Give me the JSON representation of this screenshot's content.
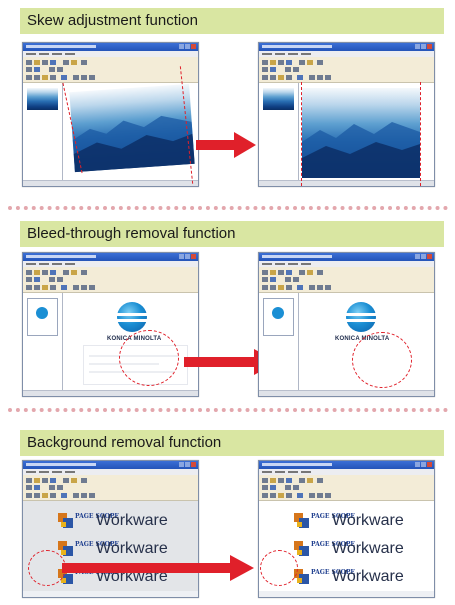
{
  "sections": [
    {
      "title": "Skew adjustment function"
    },
    {
      "title": "Bleed-through removal function"
    },
    {
      "title": "Background removal function"
    }
  ],
  "logo": {
    "brand_text": "KONICA MINOLTA"
  },
  "workware": {
    "sub_label": "PAGE SCOPE",
    "brand_text": "Workware"
  },
  "colors": {
    "header_bg": "#d9e6a2",
    "arrow_red": "#e0202a",
    "divider_pink": "#e3a7ad"
  },
  "icons": [
    "arrow-right-icon",
    "konica-minolta-logo-icon",
    "pagescope-workware-icon"
  ]
}
